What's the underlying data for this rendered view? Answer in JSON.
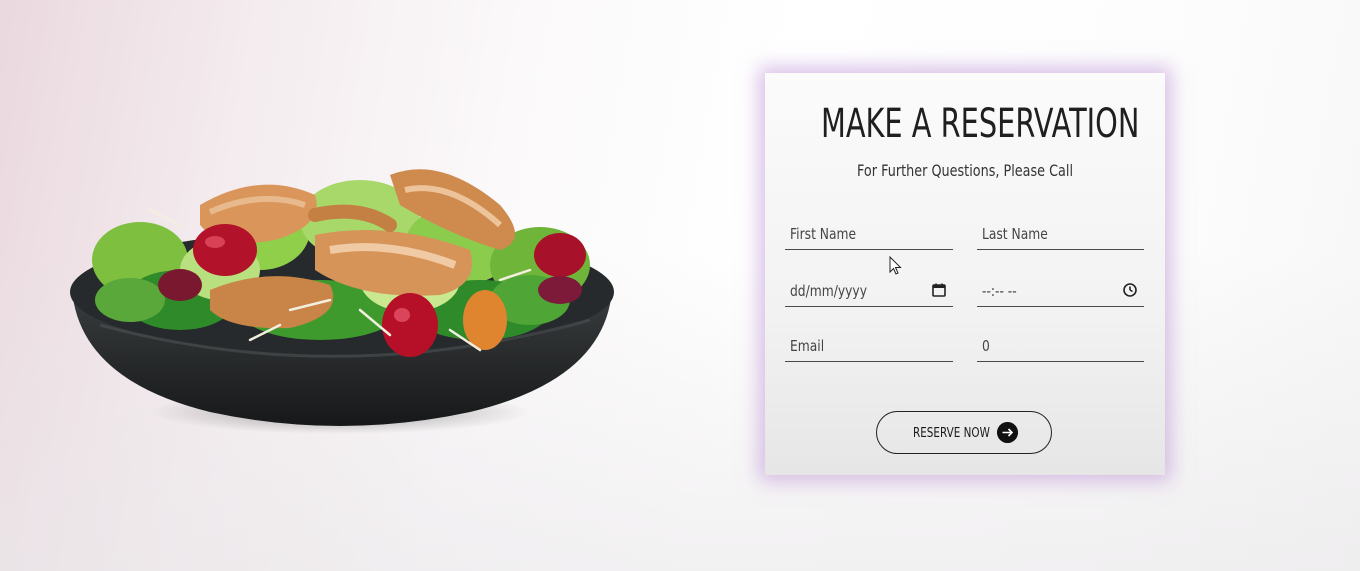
{
  "reservation": {
    "title": "MAKE A RESERVATION",
    "subtitle": "For Further Questions, Please Call",
    "fields": {
      "first_name": {
        "placeholder": "First Name"
      },
      "last_name": {
        "placeholder": "Last Name"
      },
      "date": {
        "placeholder": "dd/mm/yyyy",
        "icon": "calendar-icon"
      },
      "time": {
        "placeholder": "--:-- --",
        "icon": "clock-icon"
      },
      "email": {
        "placeholder": "Email"
      },
      "guests": {
        "value": "0"
      }
    },
    "button": {
      "label": "RESERVE NOW",
      "icon": "arrow-right-icon"
    }
  },
  "image": {
    "subject": "salad-bowl-image"
  },
  "colors": {
    "card_glow": "#ba8cd6",
    "button_border": "#222222",
    "arrow_bg": "#111111"
  }
}
